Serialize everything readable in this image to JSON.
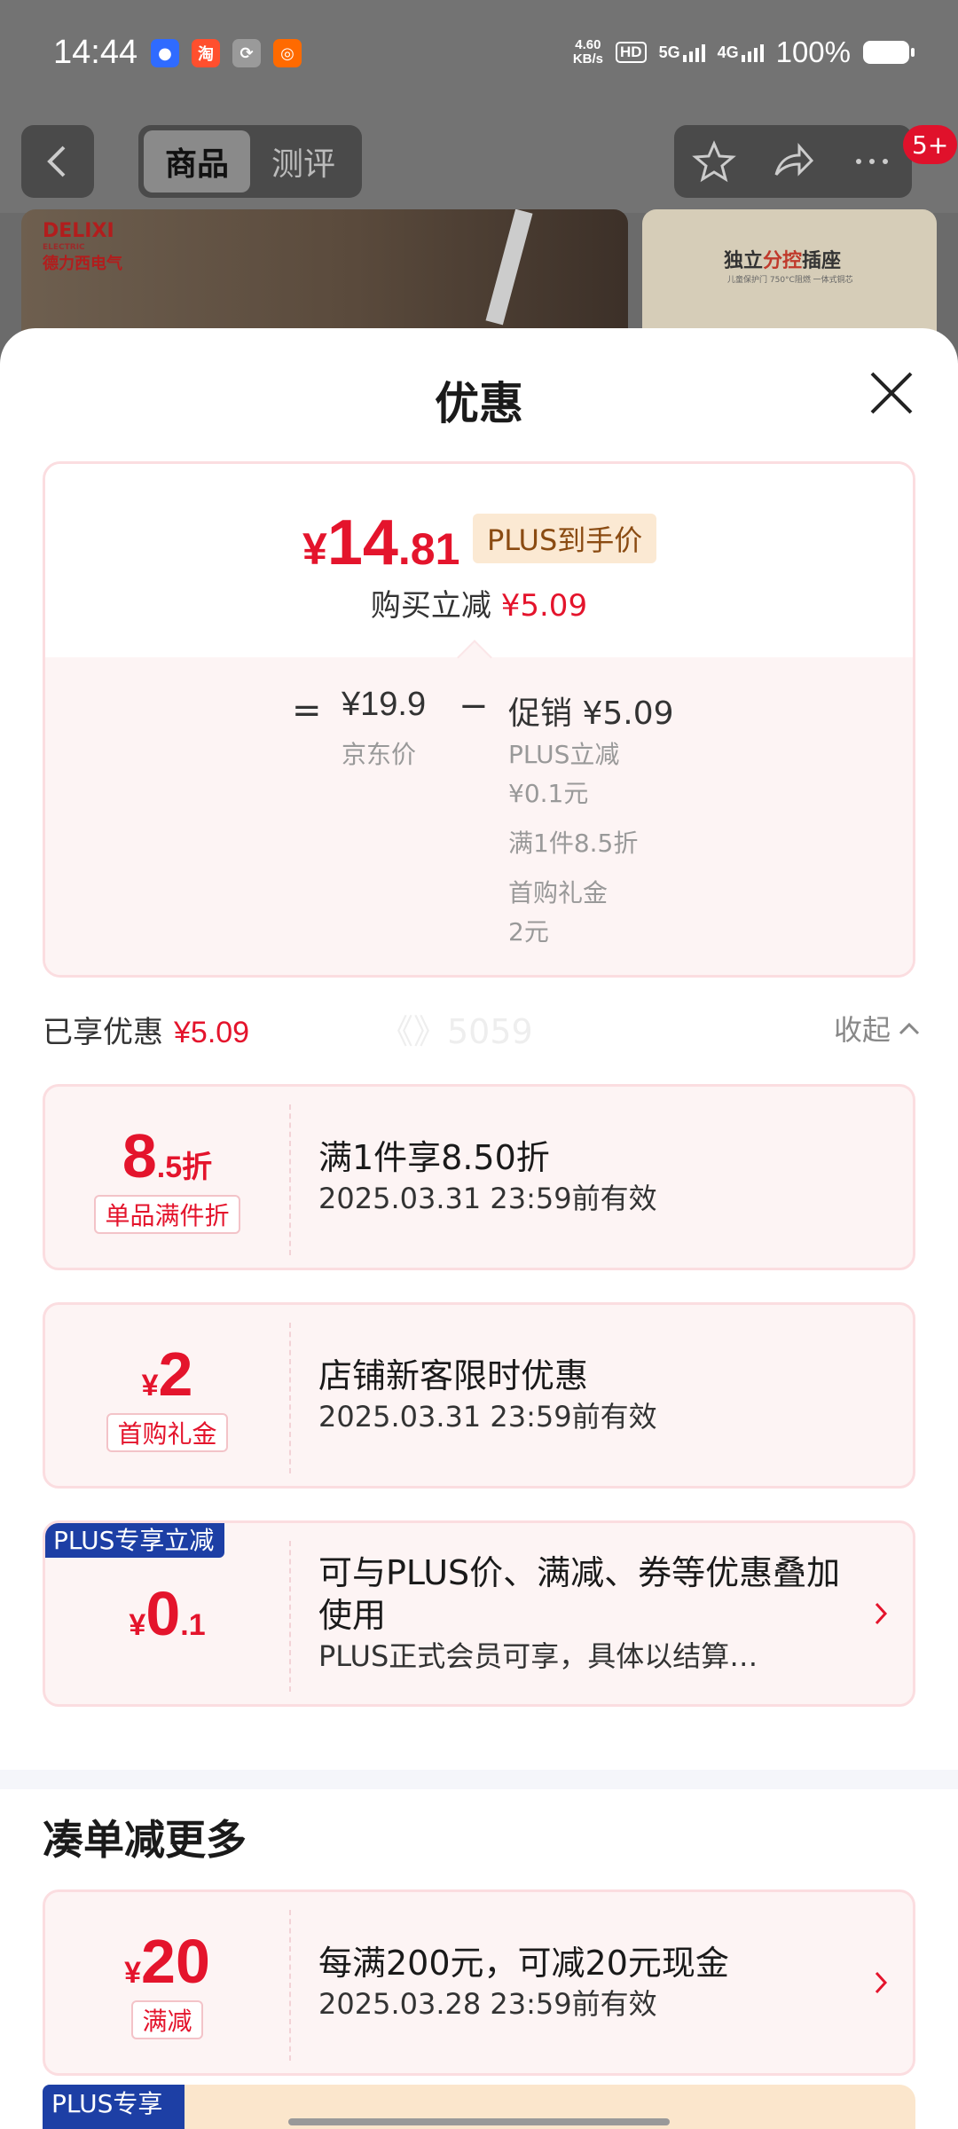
{
  "status_bar": {
    "time": "14:44",
    "net_speed_value": "4.60",
    "net_speed_unit": "KB/s",
    "hd_label": "HD",
    "sim1": "5G",
    "sim2": "4G",
    "battery": "100%"
  },
  "nav": {
    "tabs": [
      {
        "label": "商品"
      },
      {
        "label": "测评"
      }
    ],
    "badge": "5+"
  },
  "product_images": {
    "brand_name": "DELIXI",
    "brand_sub": "ELECTRIC",
    "brand_cn": "德力西电气",
    "right_title_pre": "独立",
    "right_title_hl": "分控",
    "right_title_post": "插座",
    "right_sub": "儿童保护门  750°C阻燃  一体式铜芯"
  },
  "sheet": {
    "title": "优惠"
  },
  "price_card": {
    "currency": "¥",
    "final_int": "14",
    "final_dec": ".81",
    "plus_tag": "PLUS到手价",
    "instant_cut_label": "购买立减",
    "instant_cut_value": "¥5.09",
    "eq": "=",
    "jd_price": "¥19.9",
    "jd_label": "京东价",
    "minus": "−",
    "promo_title": "促销 ¥5.09",
    "promo_items": [
      "PLUS立减\n¥0.1元",
      "满1件8.5折",
      "首购礼金\n2元"
    ]
  },
  "enjoyed": {
    "label": "已享优惠",
    "value": "¥5.09",
    "watermark": "《》5059",
    "collapse": "收起"
  },
  "coupons": [
    {
      "amount_big": "8",
      "amount_small": ".5折",
      "prefix": "",
      "tag": "单品满件折",
      "title": "满1件享8.50折",
      "sub": "2025.03.31 23:59前有效"
    },
    {
      "amount_big": "2",
      "amount_small": "",
      "prefix": "¥",
      "tag": "首购礼金",
      "title": "店铺新客限时优惠",
      "sub": "2025.03.31 23:59前有效"
    },
    {
      "corner": "PLUS专享立减",
      "amount_big": "0",
      "amount_small": ".1",
      "prefix": "¥",
      "title": "可与PLUS价、满减、券等优惠叠加使用",
      "sub": "PLUS正式会员可享，具体以结算…"
    }
  ],
  "more": {
    "title": "凑单减更多",
    "coupon": {
      "prefix": "¥",
      "amount_big": "20",
      "tag": "满减",
      "title": "每满200元，可减20元现金",
      "sub": "2025.03.28 23:59前有效"
    },
    "partial_tag": "PLUS专享"
  },
  "colors": {
    "accent_red": "#e4142c",
    "plus_blue": "#1d3fa5",
    "plus_gold_bg": "#fbe9d3"
  }
}
